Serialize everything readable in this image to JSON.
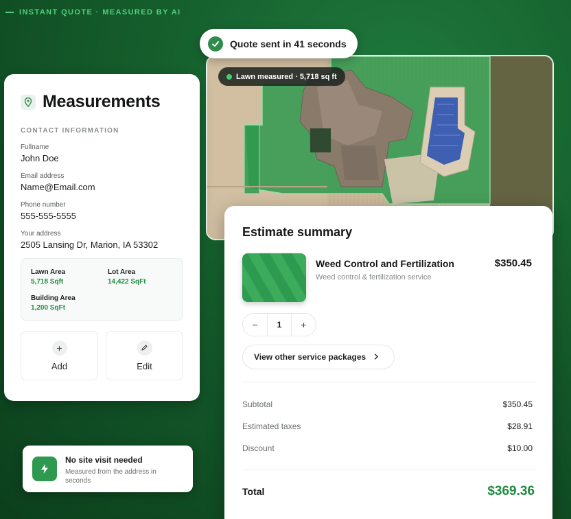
{
  "header": {
    "tagline": "INSTANT QUOTE · MEASURED BY AI"
  },
  "quote_badge": {
    "text": "Quote sent in 41 seconds",
    "icon": "check-icon"
  },
  "aerial": {
    "badge_text": "Lawn measured · 5,718 sq ft"
  },
  "measurements": {
    "title": "Measurements",
    "icon": "map-pin-icon",
    "section_label": "CONTACT INFORMATION",
    "fields": [
      {
        "label": "Fullname",
        "value": "John Doe"
      },
      {
        "label": "Email address",
        "value": "Name@Email.com"
      },
      {
        "label": "Phone number",
        "value": "555-555-5555"
      },
      {
        "label": "Your address",
        "value": "2505 Lansing Dr, Marion, IA 53302"
      }
    ],
    "areas": [
      {
        "label": "Lawn Area",
        "value": "5,718 Sqft"
      },
      {
        "label": "Lot Area",
        "value": "14,422 SqFt"
      },
      {
        "label": "Building Area",
        "value": "1,200 SqFt"
      }
    ],
    "actions": [
      {
        "label": "Add",
        "icon": "plus-icon"
      },
      {
        "label": "Edit",
        "icon": "pencil-icon"
      }
    ]
  },
  "no_site_visit": {
    "title": "No site visit needed",
    "subtitle": "Measured from the address in seconds",
    "icon": "lightning-icon"
  },
  "estimate": {
    "title": "Estimate summary",
    "service": {
      "name": "Weed Control and Fertilization",
      "description": "Weed control & fertilization service",
      "price": "$350.45",
      "quantity": "1",
      "minus": "−",
      "plus": "+"
    },
    "view_packages": "View other service packages",
    "lines": [
      {
        "label": "Subtotal",
        "value": "$350.45"
      },
      {
        "label": "Estimated taxes",
        "value": "$28.91"
      },
      {
        "label": "Discount",
        "value": "$10.00"
      }
    ],
    "total": {
      "label": "Total",
      "value": "$369.36"
    }
  },
  "colors": {
    "accent": "#2e8b4a",
    "total_green": "#1f8a41",
    "background": "#155e2c"
  }
}
